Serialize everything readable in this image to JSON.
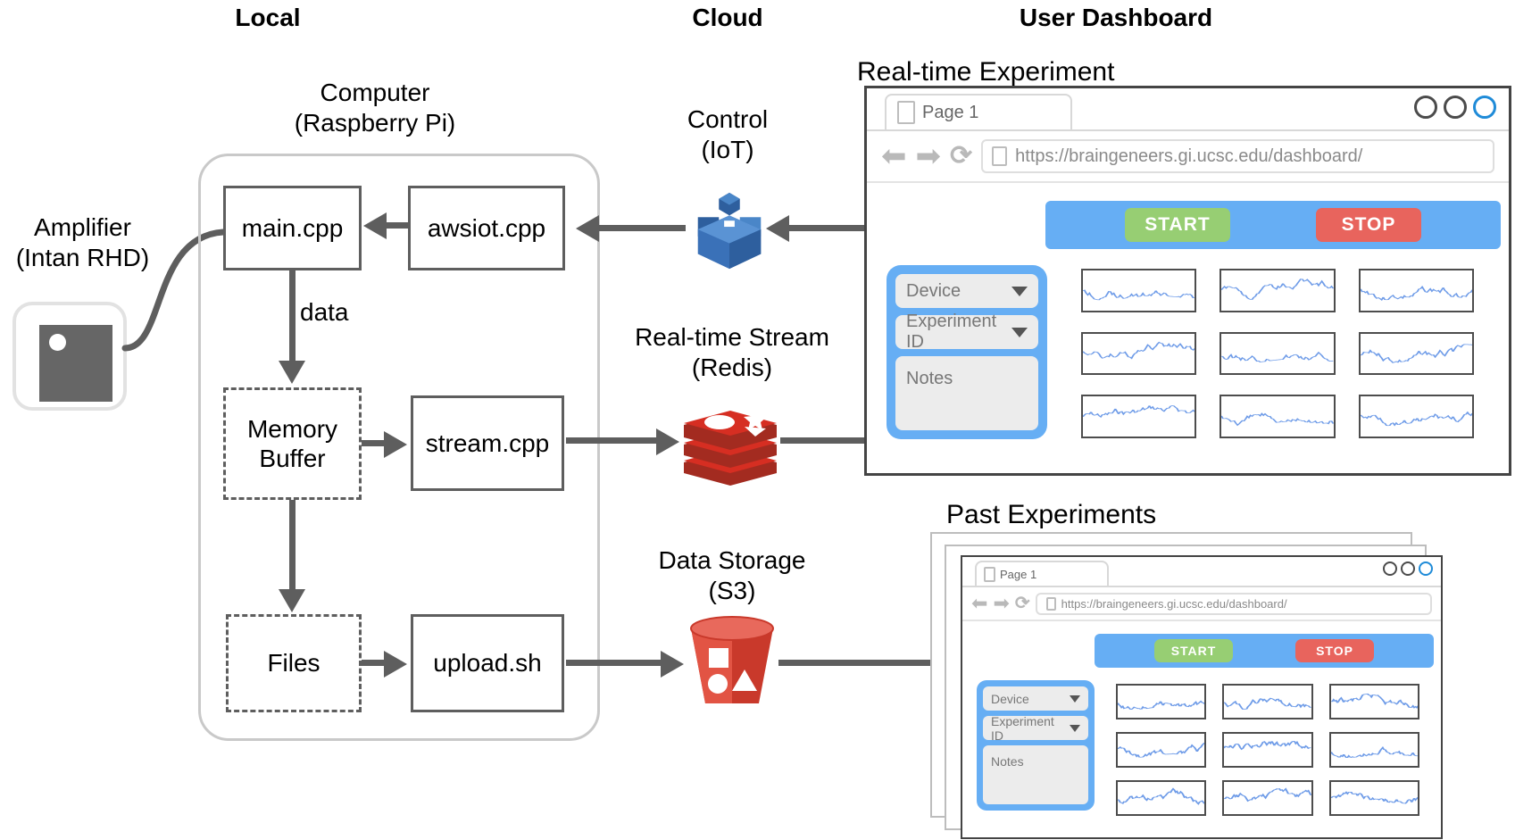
{
  "columns": {
    "local": "Local",
    "cloud": "Cloud",
    "dashboard": "User Dashboard"
  },
  "local": {
    "computer_title": "Computer",
    "computer_subtitle": "(Raspberry Pi)",
    "amplifier_title": "Amplifier",
    "amplifier_subtitle": "(Intan RHD)",
    "boxes": {
      "main": "main.cpp",
      "awsiot": "awsiot.cpp",
      "memory_buffer_line1": "Memory",
      "memory_buffer_line2": "Buffer",
      "stream": "stream.cpp",
      "files": "Files",
      "upload": "upload.sh"
    },
    "edge_label_data": "data"
  },
  "cloud": {
    "control_title": "Control",
    "control_subtitle": "(IoT)",
    "control_icon": "aws-iot-icon",
    "stream_title": "Real-time Stream",
    "stream_subtitle": "(Redis)",
    "stream_icon": "redis-icon",
    "storage_title": "Data Storage",
    "storage_subtitle": "(S3)",
    "storage_icon": "aws-s3-icon"
  },
  "dashboard": {
    "realtime_title": "Real-time Experiment",
    "past_title": "Past Experiments",
    "browser": {
      "tab_label": "Page 1",
      "tab_icon": "page-icon",
      "url": "https://braingeneers.gi.ucsc.edu/dashboard/",
      "url_icon": "page-icon",
      "back_icon": "back-arrow-icon",
      "forward_icon": "forward-arrow-icon",
      "reload_icon": "reload-icon",
      "window_controls": [
        "minimize-circle",
        "maximize-circle",
        "close-circle"
      ]
    },
    "controls": {
      "start_label": "START",
      "stop_label": "STOP",
      "device_label": "Device",
      "experiment_id_label": "Experiment ID",
      "notes_label": "Notes",
      "device_caret": "chevron-down-icon",
      "experiment_caret": "chevron-down-icon"
    },
    "plot_grid": {
      "rows": 3,
      "cols": 3,
      "trace_color": "#6f9ce8"
    }
  },
  "colors": {
    "accent_blue": "#66aef4",
    "start_green": "#97ce73",
    "stop_red": "#e8645d",
    "redis_red": "#d62e22",
    "s3_red": "#e25444",
    "iot_blue": "#3a71b8",
    "arrow_gray": "#5e5e5e",
    "box_border": "#5e5e5e"
  }
}
